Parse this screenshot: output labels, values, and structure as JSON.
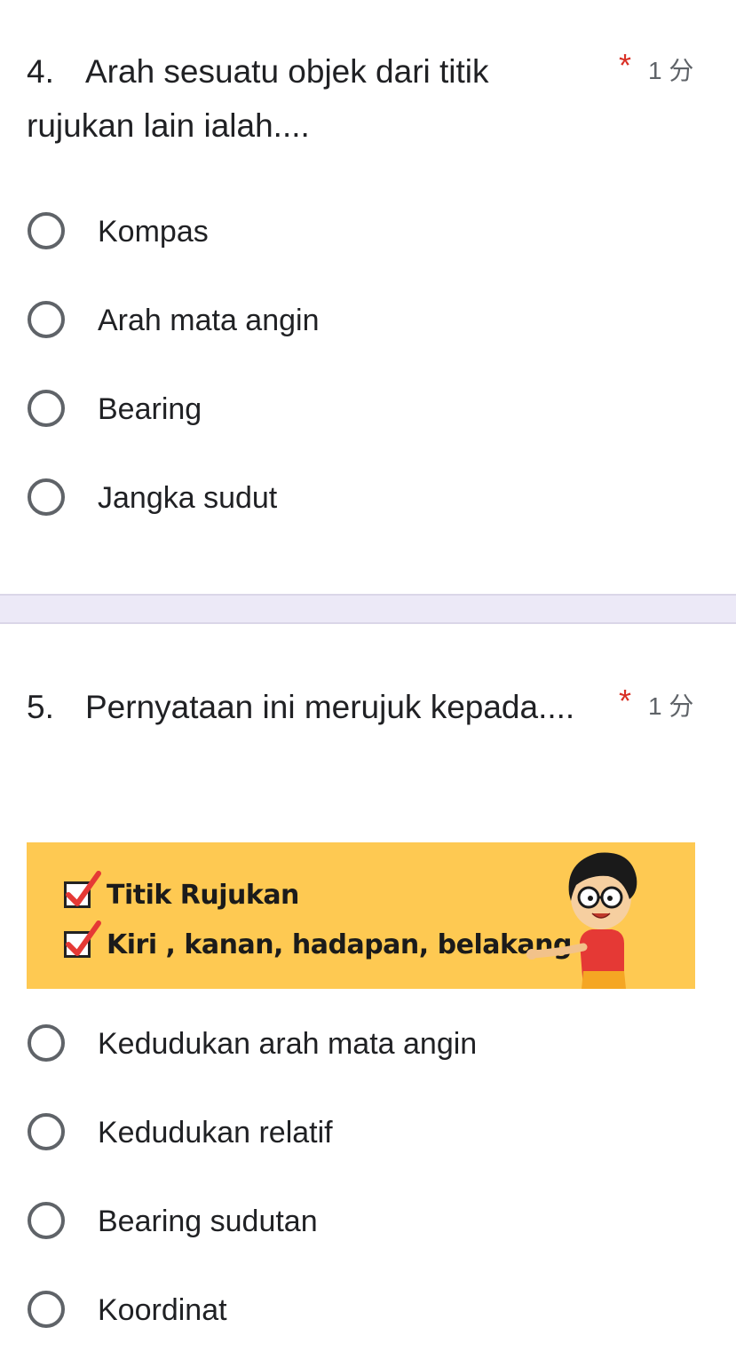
{
  "q4": {
    "number": "4.",
    "title": "Arah sesuatu objek dari titik rujukan lain ialah....",
    "required": "*",
    "points": "1 分",
    "options": [
      "Kompas",
      "Arah mata angin",
      "Bearing",
      "Jangka sudut"
    ]
  },
  "q5": {
    "number": "5.",
    "title": "Pernyataan ini merujuk kepada....",
    "required": "*",
    "points": "1 分",
    "image": {
      "lines": [
        "Titik Rujukan",
        "Kiri , kanan, hadapan, belakang"
      ]
    },
    "options": [
      "Kedudukan arah mata angin",
      "Kedudukan relatif",
      "Bearing sudutan",
      "Koordinat"
    ]
  },
  "colors": {
    "required": "#d93025",
    "banner_bg": "#fec952",
    "divider": "#ece9f7",
    "radio_border": "#5f6368"
  },
  "icons": {
    "radio": "radio-unchecked-icon",
    "check": "checkbox-checked-icon"
  }
}
